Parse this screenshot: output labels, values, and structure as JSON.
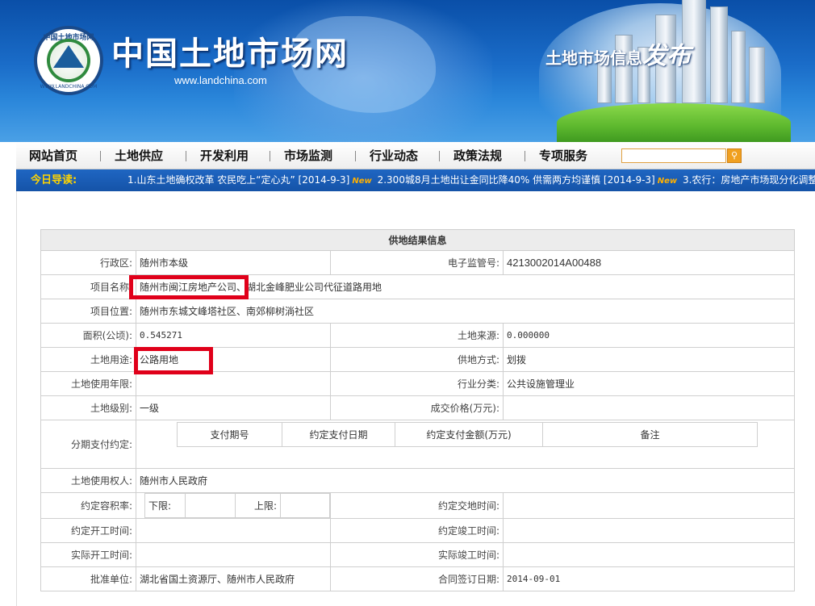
{
  "header": {
    "site_name": "中国土地市场网",
    "site_url": "www.landchina.com",
    "logo_text": "中国土地市场网",
    "logo_url": "WWW.LANDCHINA.COM",
    "slogan_prefix": "土地市场信息",
    "slogan_big": "发布"
  },
  "nav": {
    "items": [
      "网站首页",
      "土地供应",
      "开发利用",
      "市场监测",
      "行业动态",
      "政策法规",
      "专项服务"
    ],
    "search_placeholder": ""
  },
  "ticker": {
    "label": "今日导读:",
    "items": [
      {
        "text": "1.山东土地确权改革 农民吃上“定心丸”",
        "date": "[2014-9-3]"
      },
      {
        "text": "2.300城8月土地出让金同比降40% 供需两方均谨慎",
        "date": "[2014-9-3]"
      },
      {
        "text": "3.农行：房地产市场现分化调整",
        "date": ""
      }
    ],
    "new_tag": "New"
  },
  "result": {
    "title": "供地结果信息",
    "labels": {
      "district": "行政区:",
      "supervision_no": "电子监管号:",
      "project_name": "项目名称:",
      "project_location": "项目位置:",
      "area": "面积(公顷):",
      "land_source": "土地来源:",
      "land_use": "土地用途:",
      "supply_method": "供地方式:",
      "use_term": "土地使用年限:",
      "industry": "行业分类:",
      "land_grade": "土地级别:",
      "price": "成交价格(万元):",
      "installment": "分期支付约定:",
      "user": "土地使用权人:",
      "far": "约定容积率:",
      "delivery_time": "约定交地时间:",
      "start_agreed": "约定开工时间:",
      "complete_agreed": "约定竣工时间:",
      "start_actual": "实际开工时间:",
      "complete_actual": "实际竣工时间:",
      "approval_unit": "批准单位:",
      "contract_date": "合同签订日期:"
    },
    "values": {
      "district": "随州市本级",
      "supervision_no": "4213002014A00488",
      "project_name": "随州市闽江房地产公司、湖北金峰肥业公司代征道路用地",
      "project_location": "随州市东城文峰塔社区、南郊柳树淌社区",
      "area": "0.545271",
      "land_source": "0.000000",
      "land_use": "公路用地",
      "supply_method": "划拨",
      "use_term": "",
      "industry": "公共设施管理业",
      "land_grade": "一级",
      "price": "",
      "user": "随州市人民政府",
      "delivery_time": "",
      "start_agreed": "",
      "complete_agreed": "",
      "start_actual": "",
      "complete_actual": "",
      "approval_unit": "湖北省国土资源厅、随州市人民政府",
      "contract_date": "2014-09-01"
    },
    "installment_headers": [
      "支付期号",
      "约定支付日期",
      "约定支付金额(万元)",
      "备注"
    ],
    "far_lower_label": "下限:",
    "far_upper_label": "上限:",
    "far_lower": "",
    "far_upper": ""
  },
  "colors": {
    "banner_blue": "#1a6cc8",
    "ticker_blue": "#1553a8",
    "ticker_label": "#ffd400",
    "highlight_red": "#e0001a"
  }
}
